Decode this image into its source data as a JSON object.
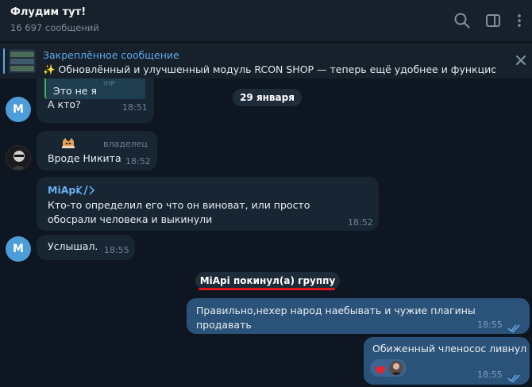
{
  "header": {
    "title": "Флудим тут!",
    "subtitle": "16 697 сообщений"
  },
  "pinned": {
    "title": "Закреплённое сообщение",
    "text": "✨ Обновлённый и улучшенный модуль RCON SHOP — теперь ещё удобнее и функцио..."
  },
  "date_separator": "29 января",
  "messages": [
    {
      "author_initial": "M",
      "quote_text": "Это не я",
      "quote_badge": "VIP",
      "text": "А кто?",
      "time": "18:51"
    },
    {
      "badge": "владелец",
      "text": "Вроде Никита",
      "time": "18:52"
    },
    {
      "author": "MiApi",
      "text": "Кто-то определил его что он виноват, или просто обосрали человека и выкинули",
      "time": "18:52"
    },
    {
      "author_initial": "M",
      "text": "Услышал.",
      "time": "18:55"
    }
  ],
  "service": "MiApi покинул(а) группу",
  "outgoing": [
    {
      "text": "Правильно,нехер народ наебывать и чужие плагины продавать",
      "time": "18:55"
    },
    {
      "text": "Обиженный членосос ливнул",
      "time": "18:55"
    }
  ],
  "colors": {
    "background": "#0e1621",
    "header": "#17212b",
    "incoming": "#182533",
    "outgoing": "#2b5278",
    "accent": "#5fa8e8",
    "avatar": "#4d9dd8",
    "underline": "#e0191c"
  },
  "icons": {
    "search": "search-icon",
    "sidebar": "sidebar-toggle-icon",
    "menu": "more-vertical-icon",
    "close": "close-icon",
    "code": "code-icon",
    "reaction": "heart-icon",
    "read": "double-check-icon"
  }
}
